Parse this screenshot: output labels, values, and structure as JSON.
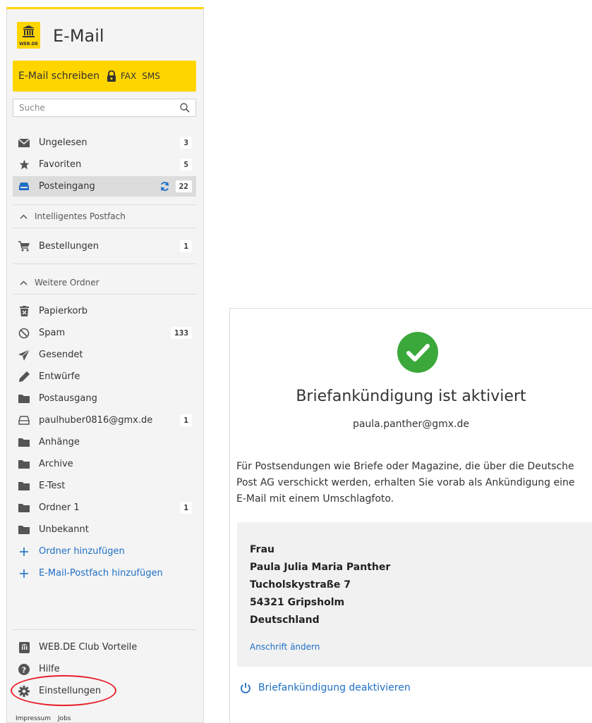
{
  "app": {
    "title": "E-Mail",
    "logo_text": "WEB.DE"
  },
  "compose": {
    "label": "E-Mail schreiben",
    "fax": "FAX",
    "sms": "SMS"
  },
  "search": {
    "placeholder": "Suche"
  },
  "quick_folders": [
    {
      "label": "Ungelesen",
      "count": "3",
      "icon": "envelope-icon"
    },
    {
      "label": "Favoriten",
      "count": "5",
      "icon": "star-icon"
    },
    {
      "label": "Posteingang",
      "count": "22",
      "icon": "inbox-icon",
      "active": true
    }
  ],
  "sections": {
    "smart": "Intelligentes Postfach",
    "more": "Weitere Ordner"
  },
  "smart_folders": [
    {
      "label": "Bestellungen",
      "count": "1",
      "icon": "cart-icon"
    }
  ],
  "folders": [
    {
      "label": "Papierkorb",
      "count": "",
      "icon": "trash-icon"
    },
    {
      "label": "Spam",
      "count": "133",
      "icon": "spam-icon"
    },
    {
      "label": "Gesendet",
      "count": "",
      "icon": "send-icon"
    },
    {
      "label": "Entwürfe",
      "count": "",
      "icon": "pencil-icon"
    },
    {
      "label": "Postausgang",
      "count": "",
      "icon": "folder-icon"
    },
    {
      "label": "paulhuber0816@gmx.de",
      "count": "1",
      "icon": "mailbox-icon"
    },
    {
      "label": "Anhänge",
      "count": "",
      "icon": "folder-icon"
    },
    {
      "label": "Archive",
      "count": "",
      "icon": "folder-icon"
    },
    {
      "label": "E-Test",
      "count": "",
      "icon": "folder-icon"
    },
    {
      "label": "Ordner 1",
      "count": "1",
      "icon": "folder-icon"
    },
    {
      "label": "Unbekannt",
      "count": "",
      "icon": "folder-icon"
    }
  ],
  "add_actions": {
    "add_folder": "Ordner hinzufügen",
    "add_mailbox": "E-Mail-Postfach hinzufügen"
  },
  "bottom_nav": {
    "club": "WEB.DE Club Vorteile",
    "help": "Hilfe",
    "settings": "Einstellungen"
  },
  "footer": {
    "impressum": "Impressum",
    "jobs": "Jobs"
  },
  "panel": {
    "title": "Briefankündigung ist aktiviert",
    "email": "paula.panther@gmx.de",
    "description": "Für Postsendungen wie Briefe oder Magazine, die über die Deutsche Post AG verschickt werden, erhalten Sie vorab als Ankündigung eine E-Mail mit einem Umschlagfoto.",
    "address": [
      "Frau",
      "Paula Julia Maria Panther",
      "Tucholskystraße 7",
      "54321 Gripsholm",
      "Deutschland"
    ],
    "change_address": "Anschrift ändern",
    "deactivate": "Briefankündigung deaktivieren"
  },
  "colors": {
    "brand_yellow": "#ffd500",
    "link_blue": "#1f6fc5",
    "success_green": "#3aa83a",
    "annotation_red": "#e8202a"
  }
}
